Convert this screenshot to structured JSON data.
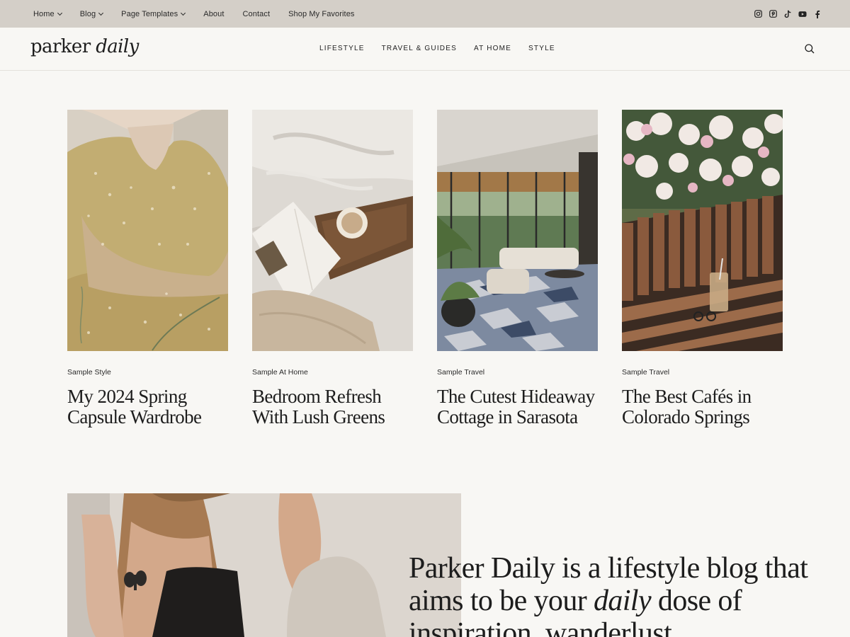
{
  "topbar": {
    "nav": [
      {
        "label": "Home"
      },
      {
        "label": "Blog"
      },
      {
        "label": "Page Templates"
      },
      {
        "label": "About"
      },
      {
        "label": "Contact"
      },
      {
        "label": "Shop My Favorites"
      }
    ],
    "social_icons": [
      "instagram-icon",
      "pinterest-icon",
      "tiktok-icon",
      "youtube-icon",
      "facebook-icon"
    ]
  },
  "header": {
    "logo_a": "parker ",
    "logo_b": "daily",
    "nav": [
      {
        "label": "LIFESTYLE"
      },
      {
        "label": "TRAVEL & GUIDES"
      },
      {
        "label": "AT HOME"
      },
      {
        "label": "STYLE"
      }
    ],
    "search_icon": "search-icon"
  },
  "posts": [
    {
      "category": "Sample Style",
      "title": "My 2024 Spring Capsule Wardrobe"
    },
    {
      "category": "Sample At Home",
      "title": "Bedroom Refresh With Lush Greens"
    },
    {
      "category": "Sample Travel",
      "title": "The Cutest Hideaway Cottage in Sarasota"
    },
    {
      "category": "Sample Travel",
      "title": "The Best Cafés in Colorado Springs"
    }
  ],
  "intro": {
    "text_a": "Parker Daily is a lifestyle blog that aims to be your ",
    "text_b": "daily",
    "text_c": " dose of inspiration, wanderlust"
  },
  "colors": {
    "topbar_bg": "#d4cfc8",
    "page_bg": "#f8f7f4",
    "text": "#1d1d1d"
  }
}
